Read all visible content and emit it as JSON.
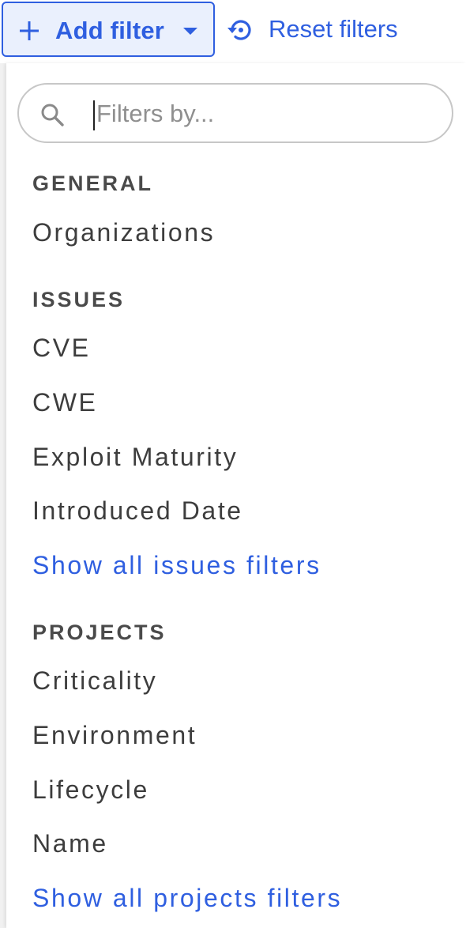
{
  "toolbar": {
    "add_filter_label": "Add filter",
    "reset_filters_label": "Reset filters",
    "add_icon": "plus-icon",
    "dropdown_icon": "caret-down-icon",
    "reset_icon": "reset-history-icon"
  },
  "search": {
    "placeholder": "Filters by...",
    "value": "",
    "icon": "search-icon"
  },
  "sections": {
    "general": {
      "title": "GENERAL",
      "items": [
        "Organizations"
      ]
    },
    "issues": {
      "title": "ISSUES",
      "items": [
        "CVE",
        "CWE",
        "Exploit Maturity",
        "Introduced Date"
      ],
      "show_all_label": "Show all issues filters"
    },
    "projects": {
      "title": "PROJECTS",
      "items": [
        "Criticality",
        "Environment",
        "Lifecycle",
        "Name"
      ],
      "show_all_label": "Show all projects filters"
    }
  },
  "colors": {
    "accent": "#2f5fe0",
    "button_bg": "#eaf0fd",
    "section_title": "#4a4a4a",
    "item_text": "#3d3d3d"
  }
}
